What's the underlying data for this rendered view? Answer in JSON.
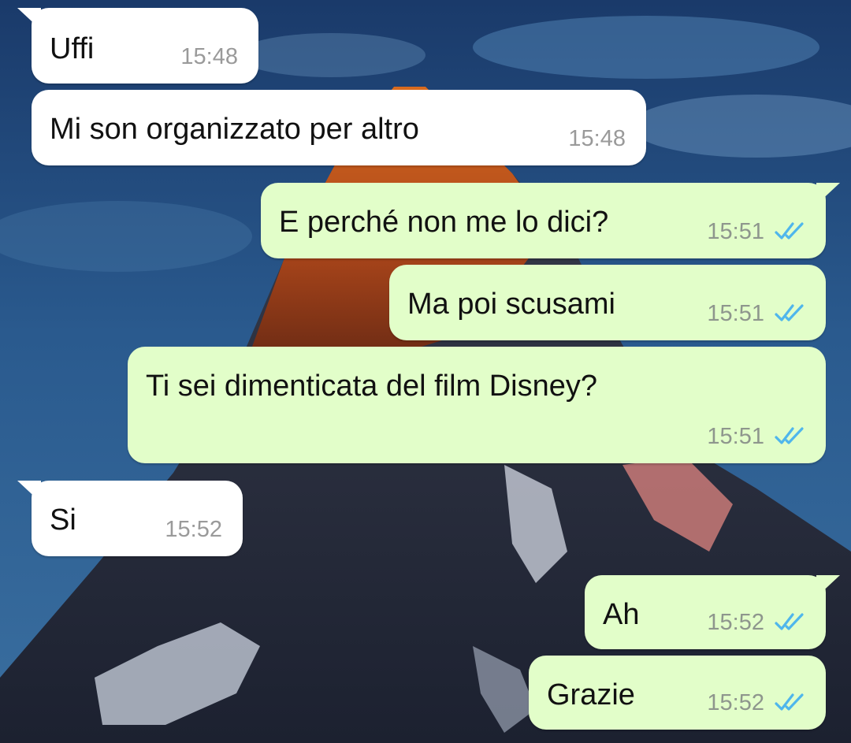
{
  "conversation": {
    "messages": [
      {
        "text": "Uffi",
        "time": "15:48",
        "direction": "incoming"
      },
      {
        "text": "Mi son organizzato per altro",
        "time": "15:48",
        "direction": "incoming"
      },
      {
        "text": "E perché non me lo dici?",
        "time": "15:51",
        "direction": "outgoing",
        "status": "read"
      },
      {
        "text": "Ma poi scusami",
        "time": "15:51",
        "direction": "outgoing",
        "status": "read"
      },
      {
        "text": "Ti sei dimenticata del film Disney?",
        "time": "15:51",
        "direction": "outgoing",
        "status": "read"
      },
      {
        "text": "Si",
        "time": "15:52",
        "direction": "incoming"
      },
      {
        "text": "Ah",
        "time": "15:52",
        "direction": "outgoing",
        "status": "read"
      },
      {
        "text": "Grazie",
        "time": "15:52",
        "direction": "outgoing",
        "status": "read"
      }
    ]
  },
  "colors": {
    "incoming_bubble": "#ffffff",
    "outgoing_bubble": "#e2fec9",
    "read_tick": "#4fb6ec",
    "timestamp": "#8e968d"
  },
  "icons": {
    "read_status": "double-check-icon",
    "wallpaper": "mountain-wallpaper"
  }
}
